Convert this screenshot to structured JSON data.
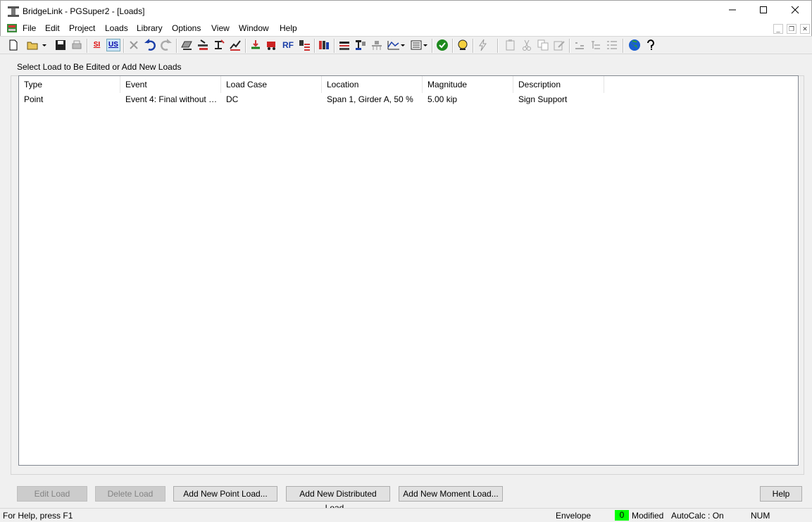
{
  "window": {
    "title": "BridgeLink - PGSuper2 - [Loads]",
    "minimize_icon": "minimize-icon",
    "maximize_icon": "maximize-icon",
    "close_icon": "close-icon"
  },
  "menu": {
    "items": [
      "File",
      "Edit",
      "Project",
      "Loads",
      "Library",
      "Options",
      "View",
      "Window",
      "Help"
    ]
  },
  "toolbar": {
    "si_label": "SI",
    "us_label": "US",
    "rf_label": "RF"
  },
  "group": {
    "label": "Select Load to Be Edited or Add New Loads"
  },
  "table": {
    "columns": [
      "Type",
      "Event",
      "Load Case",
      "Location",
      "Magnitude",
      "Description"
    ],
    "rows": [
      [
        "Point",
        "Event 4: Final without Liv...",
        "DC",
        "Span 1, Girder A, 50 %",
        "5.00 kip",
        "Sign Support"
      ]
    ]
  },
  "buttons": {
    "edit": "Edit Load",
    "delete": "Delete Load",
    "add_point": "Add New Point Load...",
    "add_distributed": "Add New Distributed Load...",
    "add_moment": "Add New Moment Load...",
    "help": "Help"
  },
  "status": {
    "help_text": "For Help, press F1",
    "envelope": "Envelope",
    "badge": "0",
    "modified": "Modified",
    "autocalc": "AutoCalc : On",
    "num": "NUM",
    "badge_color": "#00ff00"
  }
}
